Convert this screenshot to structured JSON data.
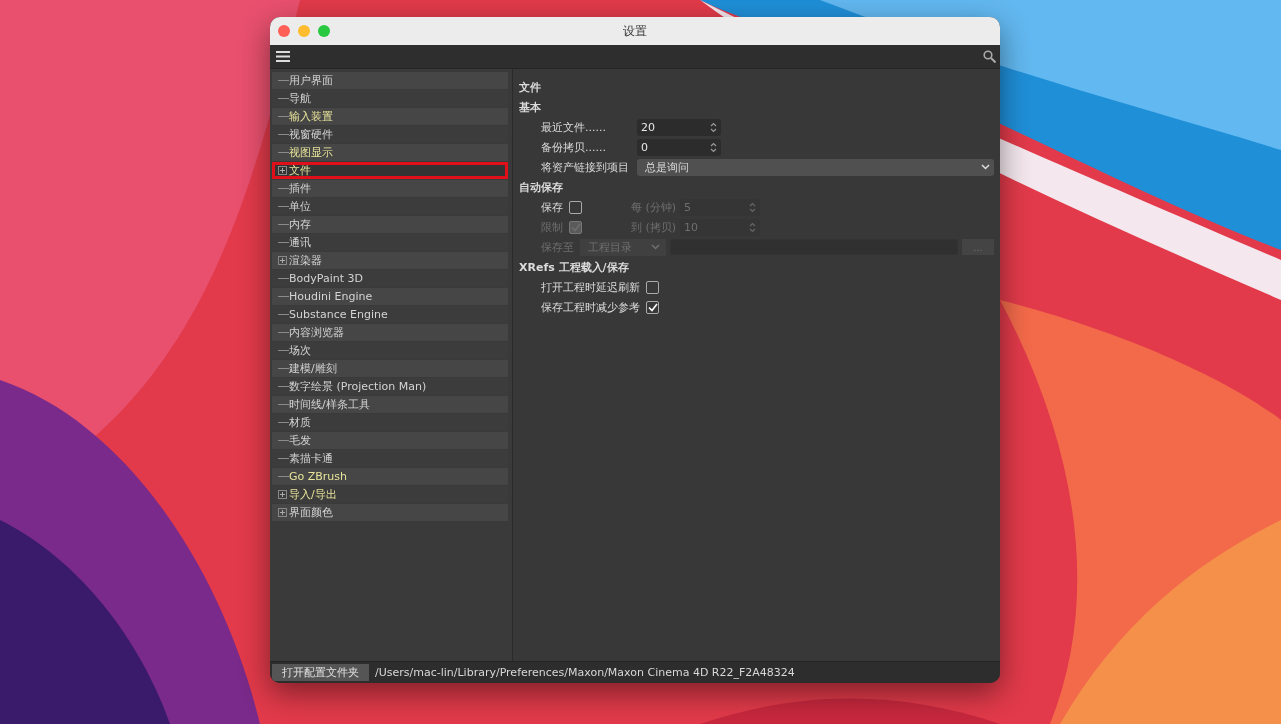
{
  "window": {
    "title": "设置"
  },
  "sidebar": {
    "items": [
      {
        "label": "用户界面",
        "kind": "leaf",
        "highlighted": false,
        "selected": false
      },
      {
        "label": "导航",
        "kind": "leaf",
        "highlighted": false,
        "selected": false
      },
      {
        "label": "输入装置",
        "kind": "leaf",
        "highlighted": true,
        "selected": false
      },
      {
        "label": "视窗硬件",
        "kind": "leaf",
        "highlighted": false,
        "selected": false
      },
      {
        "label": "视图显示",
        "kind": "leaf",
        "highlighted": true,
        "selected": false
      },
      {
        "label": "文件",
        "kind": "expandable",
        "highlighted": true,
        "selected": true
      },
      {
        "label": "插件",
        "kind": "leaf",
        "highlighted": false,
        "selected": false
      },
      {
        "label": "单位",
        "kind": "leaf",
        "highlighted": false,
        "selected": false
      },
      {
        "label": "内存",
        "kind": "leaf",
        "highlighted": false,
        "selected": false
      },
      {
        "label": "通讯",
        "kind": "leaf",
        "highlighted": false,
        "selected": false
      },
      {
        "label": "渲染器",
        "kind": "expandable",
        "highlighted": false,
        "selected": false
      },
      {
        "label": "BodyPaint 3D",
        "kind": "leaf",
        "highlighted": false,
        "selected": false
      },
      {
        "label": "Houdini Engine",
        "kind": "leaf",
        "highlighted": false,
        "selected": false
      },
      {
        "label": "Substance Engine",
        "kind": "leaf",
        "highlighted": false,
        "selected": false
      },
      {
        "label": "内容浏览器",
        "kind": "leaf",
        "highlighted": false,
        "selected": false
      },
      {
        "label": "场次",
        "kind": "leaf",
        "highlighted": false,
        "selected": false
      },
      {
        "label": "建模/雕刻",
        "kind": "leaf",
        "highlighted": false,
        "selected": false
      },
      {
        "label": "数字绘景 (Projection Man)",
        "kind": "leaf",
        "highlighted": false,
        "selected": false
      },
      {
        "label": "时间线/样条工具",
        "kind": "leaf",
        "highlighted": false,
        "selected": false
      },
      {
        "label": "材质",
        "kind": "leaf",
        "highlighted": false,
        "selected": false
      },
      {
        "label": "毛发",
        "kind": "leaf",
        "highlighted": false,
        "selected": false
      },
      {
        "label": "素描卡通",
        "kind": "leaf",
        "highlighted": false,
        "selected": false
      },
      {
        "label": "Go ZBrush",
        "kind": "leaf",
        "highlighted": true,
        "selected": false
      },
      {
        "label": "导入/导出",
        "kind": "expandable",
        "highlighted": true,
        "selected": false
      },
      {
        "label": "界面颜色",
        "kind": "expandable",
        "highlighted": false,
        "selected": false
      }
    ]
  },
  "panel": {
    "title": "文件",
    "sections": [
      {
        "title": "基本",
        "rows": [
          {
            "kind": "number",
            "label": "最近文件......",
            "value": "20"
          },
          {
            "kind": "number",
            "label": "备份拷贝......",
            "value": "0"
          },
          {
            "kind": "select",
            "label": "将资产链接到项目",
            "value": "总是询问"
          }
        ]
      },
      {
        "title": "自动保存",
        "rows": [
          {
            "kind": "check-number",
            "label": "保存",
            "checked": false,
            "disabled": false,
            "field_label": "每 (分钟)",
            "value": "5",
            "field_disabled": true
          },
          {
            "kind": "check-number",
            "label": "限制",
            "checked": true,
            "disabled": true,
            "field_label": "到 (拷贝)",
            "value": "10",
            "field_disabled": true
          },
          {
            "kind": "path",
            "label": "保存至",
            "value": "工程目录",
            "disabled": true,
            "button": "..."
          }
        ]
      },
      {
        "title": "XRefs 工程载入/保存",
        "rows": [
          {
            "kind": "check",
            "label": "打开工程时延迟刷新",
            "checked": false
          },
          {
            "kind": "check",
            "label": "保存工程时减少参考",
            "checked": true
          }
        ]
      }
    ]
  },
  "footer": {
    "button": "打开配置文件夹",
    "path": "/Users/mac-lin/Library/Preferences/Maxon/Maxon Cinema 4D R22_F2A48324"
  }
}
